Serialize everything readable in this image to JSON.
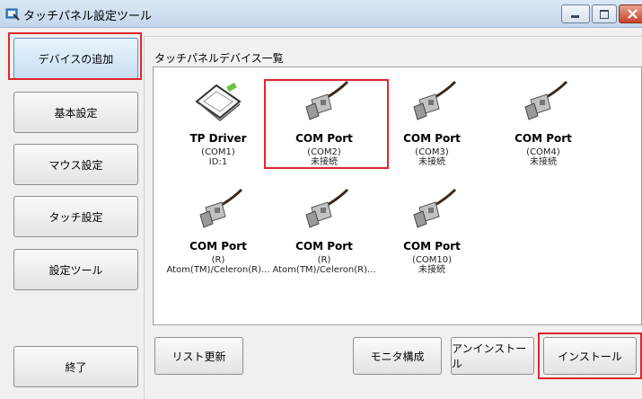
{
  "window": {
    "title": "タッチパネル設定ツール"
  },
  "sidebar": {
    "items": [
      {
        "label": "デバイスの追加"
      },
      {
        "label": "基本設定"
      },
      {
        "label": "マウス設定"
      },
      {
        "label": "タッチ設定"
      },
      {
        "label": "設定ツール"
      }
    ],
    "exit_label": "終了"
  },
  "main": {
    "list_title": "タッチパネルデバイス一覧",
    "devices": [
      {
        "name": "TP Driver",
        "line1": "(COM1)",
        "line2": "ID:1",
        "icon": "touch-panel-icon"
      },
      {
        "name": "COM Port",
        "line1": "(COM2)",
        "line2": "未接続",
        "icon": "serial-port-icon"
      },
      {
        "name": "COM Port",
        "line1": "(COM3)",
        "line2": "未接続",
        "icon": "serial-port-icon"
      },
      {
        "name": "COM Port",
        "line1": "(COM4)",
        "line2": "未接続",
        "icon": "serial-port-icon"
      },
      {
        "name": "COM Port",
        "line1": "(R)",
        "line2": "Atom(TM)/Celeron(R)...",
        "icon": "serial-port-icon"
      },
      {
        "name": "COM Port",
        "line1": "(R)",
        "line2": "Atom(TM)/Celeron(R)...",
        "icon": "serial-port-icon"
      },
      {
        "name": "COM Port",
        "line1": "(COM10)",
        "line2": "未接続",
        "icon": "serial-port-icon"
      }
    ],
    "buttons": {
      "refresh": "リスト更新",
      "monitor": "モニタ構成",
      "uninstall": "アンインストール",
      "install": "インストール"
    }
  },
  "colors": {
    "highlight": "#e0262b",
    "accent": "#5f8dbd"
  }
}
